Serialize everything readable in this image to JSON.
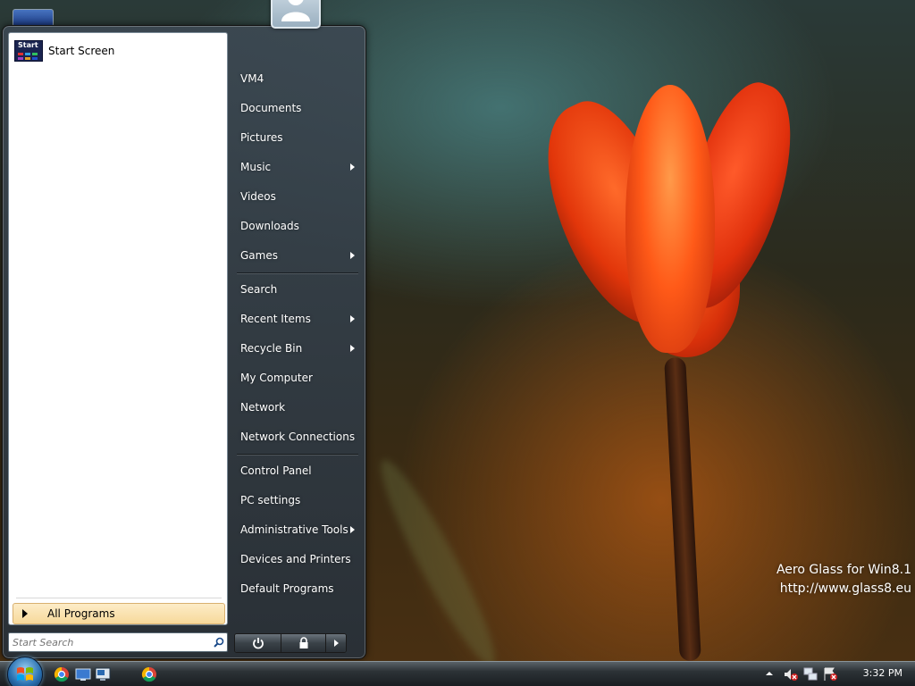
{
  "desktop": {
    "watermark_line1": "Aero Glass for Win8.1",
    "watermark_line2": "http://www.glass8.eu"
  },
  "start_menu": {
    "pinned": [
      {
        "label": "Start Screen",
        "icon": "start-screen-icon",
        "icon_text": "Start"
      }
    ],
    "all_programs_label": "All Programs",
    "search": {
      "placeholder": "Start Search",
      "value": ""
    },
    "right_items": [
      {
        "label": "VM4",
        "has_submenu": false
      },
      {
        "label": "Documents",
        "has_submenu": false
      },
      {
        "label": "Pictures",
        "has_submenu": false
      },
      {
        "label": "Music",
        "has_submenu": true
      },
      {
        "label": "Videos",
        "has_submenu": false
      },
      {
        "label": "Downloads",
        "has_submenu": false
      },
      {
        "label": "Games",
        "has_submenu": true
      },
      {
        "label": "Search",
        "has_submenu": false
      },
      {
        "label": "Recent Items",
        "has_submenu": true
      },
      {
        "label": "Recycle Bin",
        "has_submenu": true
      },
      {
        "label": "My Computer",
        "has_submenu": false
      },
      {
        "label": "Network",
        "has_submenu": false
      },
      {
        "label": "Network Connections",
        "has_submenu": false
      },
      {
        "label": "Control Panel",
        "has_submenu": false
      },
      {
        "label": "PC settings",
        "has_submenu": false
      },
      {
        "label": "Administrative Tools",
        "has_submenu": true
      },
      {
        "label": "Devices and Printers",
        "has_submenu": false
      },
      {
        "label": "Default Programs",
        "has_submenu": false
      }
    ],
    "power_buttons": [
      "power-icon",
      "lock-icon",
      "arrow-right-icon"
    ]
  },
  "taskbar": {
    "pinned_icons": [
      "chrome-icon",
      "desktop-icon",
      "remote-desktop-icon",
      "chrome-icon"
    ],
    "tray_icons": [
      "show-hidden-icons-arrow",
      "volume-muted-icon",
      "network-icon",
      "action-center-icon"
    ],
    "clock": "3:32 PM"
  },
  "colors": {
    "all_programs_highlight": "#f7d99a",
    "menu_glass": "#3c4852",
    "accent_orb": "#2a70b0"
  }
}
